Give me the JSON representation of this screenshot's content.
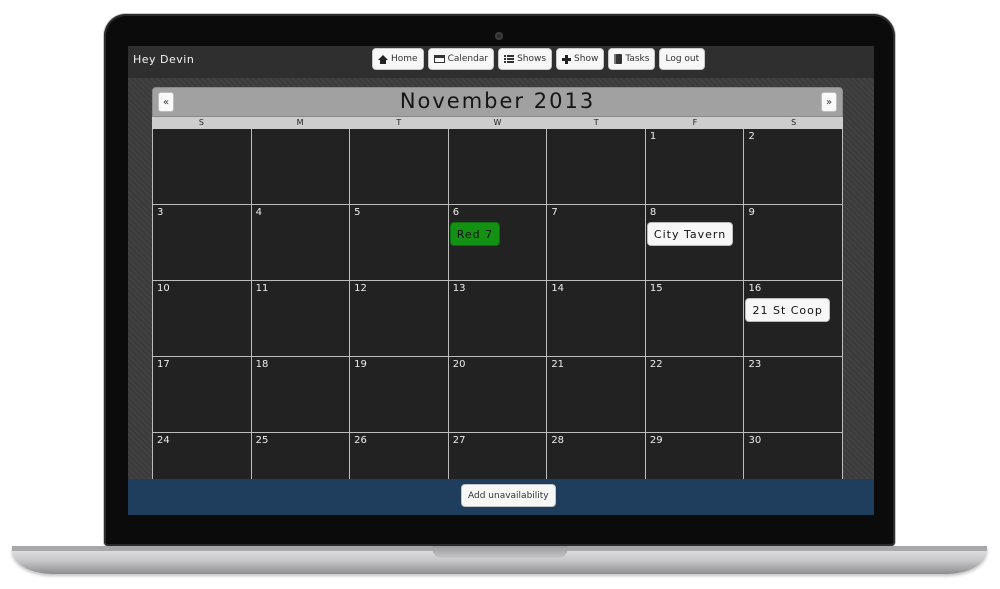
{
  "header": {
    "greeting": "Hey Devin",
    "nav": [
      {
        "label": "Home",
        "icon": "home-icon"
      },
      {
        "label": "Calendar",
        "icon": "calendar-icon"
      },
      {
        "label": "Shows",
        "icon": "list-icon"
      },
      {
        "label": "Show",
        "icon": "plus-icon"
      },
      {
        "label": "Tasks",
        "icon": "book-icon"
      },
      {
        "label": "Log out",
        "icon": ""
      }
    ]
  },
  "calendar": {
    "month_title": "November 2013",
    "prev_label": "«",
    "next_label": "»",
    "weekdays": [
      "S",
      "M",
      "T",
      "W",
      "T",
      "F",
      "S"
    ],
    "weeks": [
      [
        "",
        "",
        "",
        "",
        "",
        "1",
        "2"
      ],
      [
        "3",
        "4",
        "5",
        "6",
        "7",
        "8",
        "9"
      ],
      [
        "10",
        "11",
        "12",
        "13",
        "14",
        "15",
        "16"
      ],
      [
        "17",
        "18",
        "19",
        "20",
        "21",
        "22",
        "23"
      ],
      [
        "24",
        "25",
        "26",
        "27",
        "28",
        "29",
        "30"
      ]
    ],
    "events": [
      {
        "day": "6",
        "label": "Red 7",
        "style": "green"
      },
      {
        "day": "8",
        "label": "City Tavern",
        "style": "white"
      },
      {
        "day": "16",
        "label": "21 St Coop",
        "style": "white"
      }
    ]
  },
  "footer": {
    "add_unavailability_label": "Add unavailability"
  },
  "colors": {
    "topbar": "#2f2f2f",
    "cell_bg": "#222222",
    "event_green": "#129112",
    "footer_bar": "#1f3d5c"
  }
}
